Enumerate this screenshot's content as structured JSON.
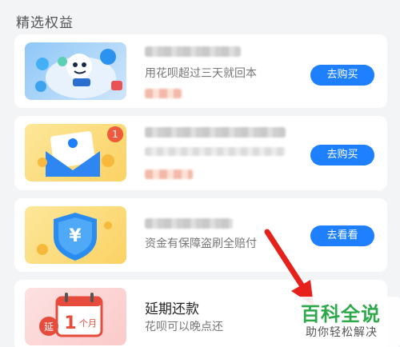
{
  "section": {
    "title": "精选权益"
  },
  "cards": [
    {
      "subtitle": "用花呗超过三天就回本",
      "button": "去购买"
    },
    {
      "button": "去购买"
    },
    {
      "subtitle": "资金有保障盗刷全赔付",
      "button": "去看看"
    },
    {
      "title": "延期还款",
      "subtitle": "花呗可以晚点还",
      "thumb_calendar_day": "1",
      "thumb_calendar_unit": "个月",
      "thumb_badge": "延"
    }
  ],
  "badge": {
    "count": "1"
  },
  "watermark": {
    "title": "百科全说",
    "subtitle": "助你轻松解决"
  },
  "colors": {
    "accent_blue": "#1e80ff",
    "arrow_red": "#e6201b",
    "watermark_green": "#2ea84a"
  }
}
